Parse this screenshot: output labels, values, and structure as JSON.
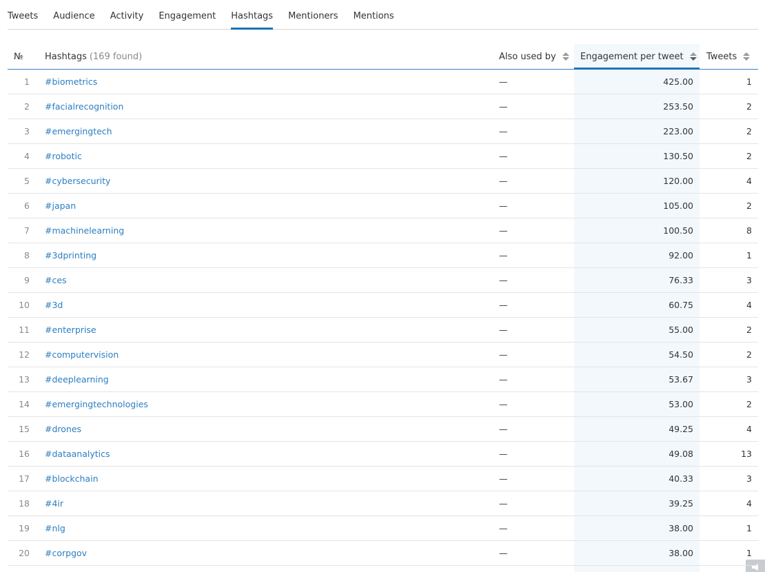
{
  "tabs": [
    {
      "label": "Tweets",
      "active": false
    },
    {
      "label": "Audience",
      "active": false
    },
    {
      "label": "Activity",
      "active": false
    },
    {
      "label": "Engagement",
      "active": false
    },
    {
      "label": "Hashtags",
      "active": true
    },
    {
      "label": "Mentioners",
      "active": false
    },
    {
      "label": "Mentions",
      "active": false
    }
  ],
  "table": {
    "headers": {
      "number": "№",
      "hashtags": "Hashtags",
      "found": "(169 found)",
      "also_used_by": "Also used by",
      "engagement": "Engagement per tweet",
      "tweets": "Tweets"
    },
    "rows": [
      {
        "n": "1",
        "tag": "#biometrics",
        "also": "—",
        "eng": "425.00",
        "tweets": "1"
      },
      {
        "n": "2",
        "tag": "#facialrecognition",
        "also": "—",
        "eng": "253.50",
        "tweets": "2"
      },
      {
        "n": "3",
        "tag": "#emergingtech",
        "also": "—",
        "eng": "223.00",
        "tweets": "2"
      },
      {
        "n": "4",
        "tag": "#robotic",
        "also": "—",
        "eng": "130.50",
        "tweets": "2"
      },
      {
        "n": "5",
        "tag": "#cybersecurity",
        "also": "—",
        "eng": "120.00",
        "tweets": "4"
      },
      {
        "n": "6",
        "tag": "#japan",
        "also": "—",
        "eng": "105.00",
        "tweets": "2"
      },
      {
        "n": "7",
        "tag": "#machinelearning",
        "also": "—",
        "eng": "100.50",
        "tweets": "8"
      },
      {
        "n": "8",
        "tag": "#3dprinting",
        "also": "—",
        "eng": "92.00",
        "tweets": "1"
      },
      {
        "n": "9",
        "tag": "#ces",
        "also": "—",
        "eng": "76.33",
        "tweets": "3"
      },
      {
        "n": "10",
        "tag": "#3d",
        "also": "—",
        "eng": "60.75",
        "tweets": "4"
      },
      {
        "n": "11",
        "tag": "#enterprise",
        "also": "—",
        "eng": "55.00",
        "tweets": "2"
      },
      {
        "n": "12",
        "tag": "#computervision",
        "also": "—",
        "eng": "54.50",
        "tweets": "2"
      },
      {
        "n": "13",
        "tag": "#deeplearning",
        "also": "—",
        "eng": "53.67",
        "tweets": "3"
      },
      {
        "n": "14",
        "tag": "#emergingtechnologies",
        "also": "—",
        "eng": "53.00",
        "tweets": "2"
      },
      {
        "n": "15",
        "tag": "#drones",
        "also": "—",
        "eng": "49.25",
        "tweets": "4"
      },
      {
        "n": "16",
        "tag": "#dataanalytics",
        "also": "—",
        "eng": "49.08",
        "tweets": "13"
      },
      {
        "n": "17",
        "tag": "#blockchain",
        "also": "—",
        "eng": "40.33",
        "tweets": "3"
      },
      {
        "n": "18",
        "tag": "#4ir",
        "also": "—",
        "eng": "39.25",
        "tweets": "4"
      },
      {
        "n": "19",
        "tag": "#nlg",
        "also": "—",
        "eng": "38.00",
        "tweets": "1"
      },
      {
        "n": "20",
        "tag": "#corpgov",
        "also": "—",
        "eng": "38.00",
        "tweets": "1"
      }
    ]
  }
}
